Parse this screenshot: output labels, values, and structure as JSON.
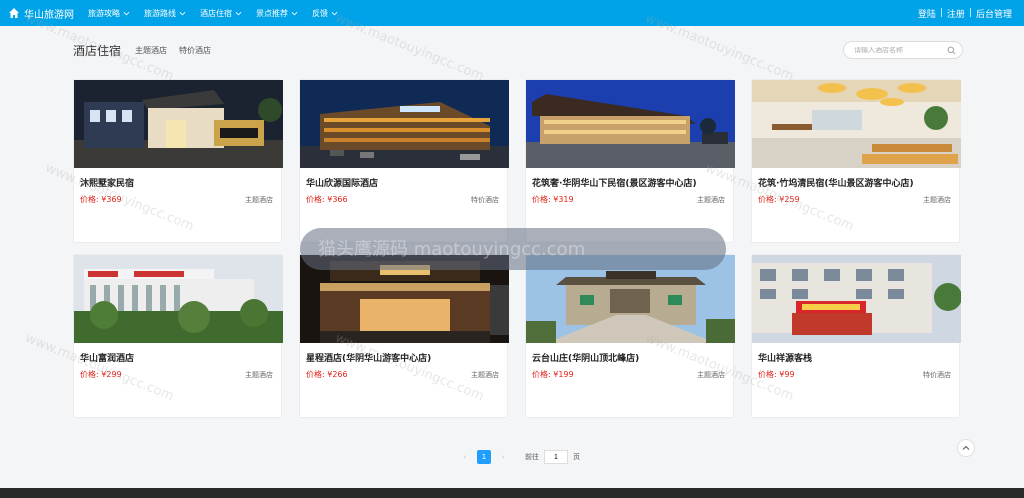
{
  "header": {
    "brand": "华山旅游网",
    "nav": [
      {
        "label": "旅游攻略"
      },
      {
        "label": "旅游路线"
      },
      {
        "label": "酒店住宿"
      },
      {
        "label": "景点推荐"
      },
      {
        "label": "反馈"
      }
    ],
    "login": "登陆",
    "register": "注册",
    "admin": "后台管理",
    "sep": "|"
  },
  "subhead": {
    "title": "酒店住宿",
    "tabs": [
      "主题酒店",
      "特价酒店"
    ],
    "search_placeholder": "请输入酒店名称"
  },
  "price_prefix": "价格: ¥",
  "hotels": [
    {
      "name": "沐熙墅家民宿",
      "price": "369",
      "type": "主题酒店"
    },
    {
      "name": "华山欣源国际酒店",
      "price": "366",
      "type": "特价酒店"
    },
    {
      "name": "花筑奢·华阴华山下民宿(景区游客中心店)",
      "price": "319",
      "type": "主题酒店"
    },
    {
      "name": "花筑·竹坞清民宿(华山景区游客中心店)",
      "price": "259",
      "type": "主题酒店"
    },
    {
      "name": "华山富润酒店",
      "price": "299",
      "type": "主题酒店"
    },
    {
      "name": "星程酒店(华阴华山游客中心店)",
      "price": "266",
      "type": "主题酒店"
    },
    {
      "name": "云台山庄(华阴山顶北峰店)",
      "price": "199",
      "type": "主题酒店"
    },
    {
      "name": "华山祥源客栈",
      "price": "99",
      "type": "特价酒店"
    }
  ],
  "pager": {
    "prev": "‹",
    "current": "1",
    "next": "›",
    "goto_label": "前往",
    "goto_value": "1",
    "page_label": "页"
  },
  "watermark": {
    "text": "猫头鹰源码 maotouyingcc.com",
    "site": "www.maotouyingcc.com"
  }
}
